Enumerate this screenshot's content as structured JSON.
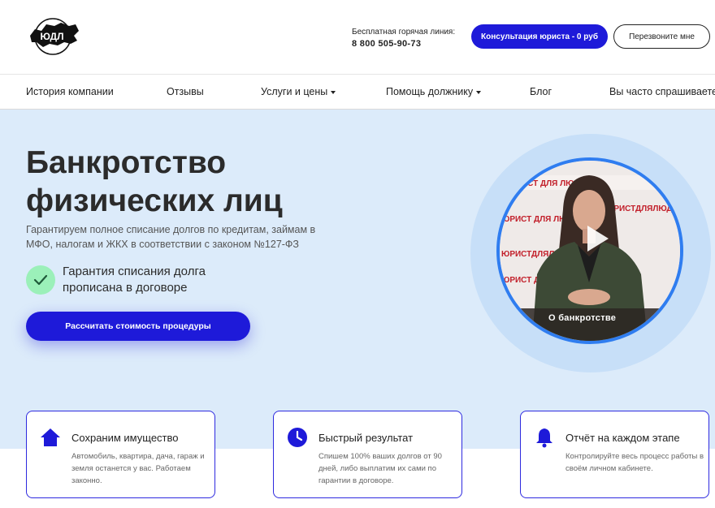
{
  "header": {
    "logo_text": "ЮДЛ",
    "hotline_label": "Бесплатная горячая линия:",
    "hotline_phone": "8 800 505-90-73",
    "consult_button": "Консультация юриста - 0 руб",
    "callback_button": "Перезвоните мне"
  },
  "nav": {
    "items": [
      {
        "label": "История компании",
        "dropdown": false
      },
      {
        "label": "Отзывы",
        "dropdown": false
      },
      {
        "label": "Услуги и цены",
        "dropdown": true
      },
      {
        "label": "Помощь должнику",
        "dropdown": true
      },
      {
        "label": "Блог",
        "dropdown": false
      },
      {
        "label": "Вы часто спрашиваете",
        "dropdown": false
      }
    ]
  },
  "hero": {
    "title": "Банкротство физических лиц",
    "subtitle": "Гарантируем полное списание долгов по кредитам, займам в МФО, налогам и ЖКХ в соответствии с законом №127-ФЗ",
    "guarantee": "Гарантия списания долга прописана в договоре",
    "cta_button": "Рассчитать стоимость процедуры",
    "video_caption": "О банкротстве",
    "video_banner_texts": [
      "ЮРИСТ ДЛЯ ЛЮДЕЙ",
      "ЮРИСТДЛЯЛЮДЕЙ.РФ",
      "ЮРИСТ ДЛЯ ЛЮДЕЙ",
      "ЮРИСТДЛЯЛЮДЕЙ.РФ",
      "ЮРИСТ ДЛЯ"
    ]
  },
  "features": [
    {
      "icon": "home-icon",
      "title": "Сохраним имущество",
      "desc": "Автомобиль, квартира, дача, гараж и земля останется у вас. Работаем законно."
    },
    {
      "icon": "clock-icon",
      "title": "Быстрый результат",
      "desc": "Спишем 100% ваших долгов от 90 дней, либо выплатим их сами по гарантии в договоре."
    },
    {
      "icon": "bell-icon",
      "title": "Отчёт на каждом этапе",
      "desc": "Контролируйте весь процесс работы в своём личном кабинете."
    }
  ],
  "colors": {
    "accent": "#1e1ad9",
    "hero_bg": "#dcebfa",
    "check_bg": "#9bf0b9"
  }
}
